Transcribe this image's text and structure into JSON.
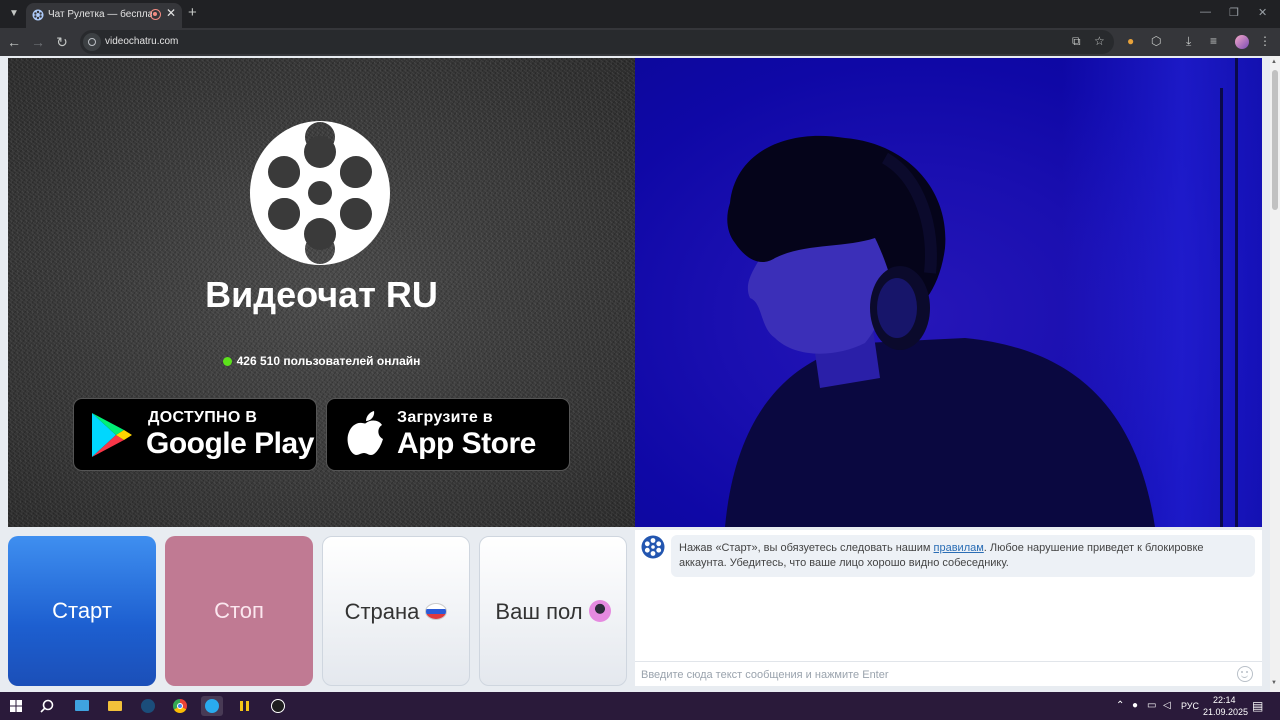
{
  "browser": {
    "tab_title": "Чат Рулетка — бесплатный",
    "tab_close": "✕",
    "new_tab": "+",
    "url": "videochatru.com",
    "window_controls": [
      "—",
      "❐",
      "✕"
    ]
  },
  "hero": {
    "brand_title": "Видеочат RU",
    "online_text": "426 510 пользователей онлайн",
    "google_play": {
      "small": "ДОСТУПНО В",
      "big": "Google Play"
    },
    "app_store": {
      "small": "Загрузите в",
      "big": "App Store"
    }
  },
  "controls": {
    "start_label": "Старт",
    "stop_label": "Стоп",
    "country_label": "Страна",
    "gender_label": "Ваш пол"
  },
  "chat": {
    "message_before_link": "Нажав «Старт», вы обязуетесь следовать нашим ",
    "rules_link": "правилам",
    "message_after_link": ". Любое нарушение приведет к блокировке аккаунта. Убедитесь, что ваше лицо хорошо видно собеседнику.",
    "input_placeholder": "Введите сюда текст сообщения и нажмите Enter"
  },
  "taskbar": {
    "language": "РУС",
    "time": "22:14",
    "date": "21.09.2025"
  },
  "colors": {
    "start_button": "#1d5fd0",
    "stop_button": "#c07a93",
    "online_dot": "#5ce21b",
    "remote_video_tint": "#1a0fb0"
  }
}
